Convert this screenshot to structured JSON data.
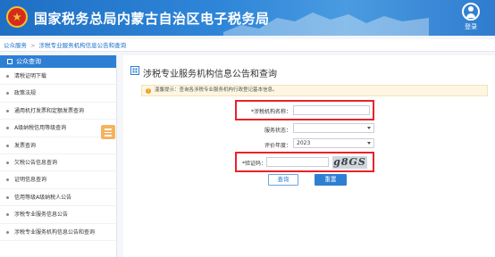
{
  "header": {
    "title": "国家税务总局内蒙古自治区电子税务局",
    "login_label": "登录"
  },
  "breadcrumb": {
    "items": [
      "公众服务",
      "涉税专业服务机构信息公告和查询"
    ],
    "separator": ">"
  },
  "sidebar": {
    "heading": "公众查询",
    "items": [
      "清税证明下载",
      "政策法规",
      "通用机打发票和定额发票查询",
      "A级纳税信用等级查询",
      "发票查询",
      "欠税公告信息查询",
      "证明信息查询",
      "信用等级A级纳税人公告",
      "涉税专业服务信息公告",
      "涉税专业服务机构信息公告和查询"
    ]
  },
  "main": {
    "title": "涉税专业服务机构信息公告和查询",
    "tip": "温馨提示：查询各涉税专业服务机构行政登记基本信息。",
    "form": {
      "org_name_label": "*涉税机构名称：",
      "org_name_value": "",
      "status_label": "服务状态：",
      "status_value": "",
      "year_label": "评价年度：",
      "year_value": "2023",
      "captcha_label": "*验证码：",
      "captcha_value": "",
      "captcha_text": "g8GS"
    },
    "query_button": "查询",
    "reset_button": "重置"
  },
  "colors": {
    "header": "#2f86d8",
    "primary": "#2d7fd4",
    "highlight": "#e8232a",
    "tip_bg": "#fdf6e3",
    "toggle": "#f6b35d"
  },
  "icons": [
    "emblem-icon",
    "user-icon",
    "list-icon",
    "building-icon",
    "warning-icon",
    "menu-toggle-icon",
    "dropdown-caret-icon"
  ]
}
